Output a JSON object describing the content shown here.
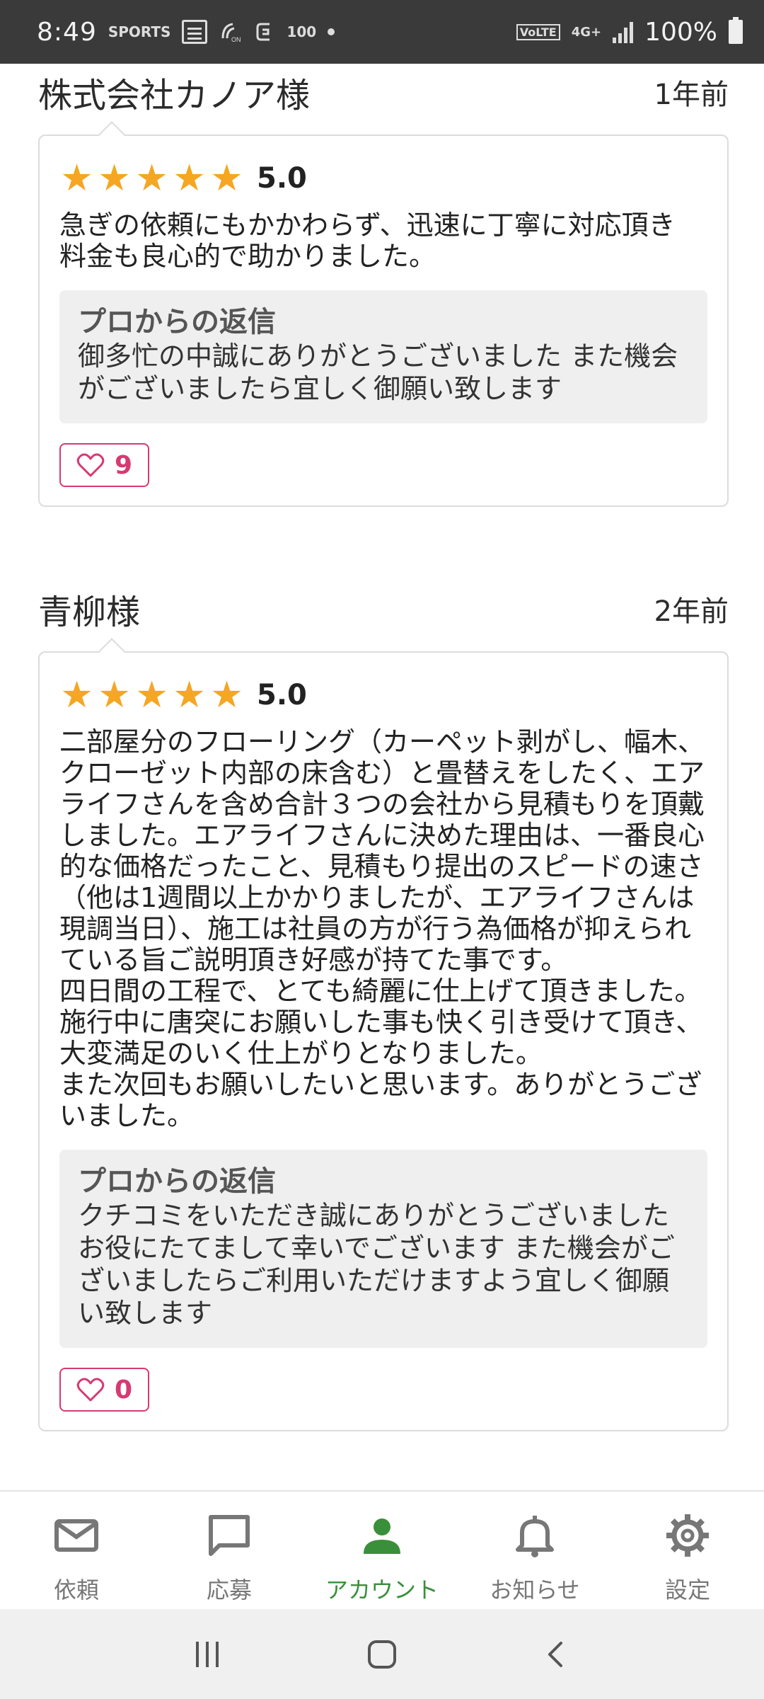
{
  "status_bar": {
    "time": "8:49",
    "left_icons": [
      "sports-news-icon",
      "calendar-icon",
      "nfc-icon",
      "app-icon"
    ],
    "notif_text": "SPORTS",
    "count_text": "100",
    "network_label": "VoLTE",
    "net_type": "4G+",
    "battery_pct": "100%"
  },
  "reviews": [
    {
      "name": "株式会社カノア様",
      "date": "1年前",
      "rating": 5,
      "score": "5.0",
      "comment": "急ぎの依頼にもかかわらず、迅速に丁寧に対応頂き\n料金も良心的で助かりました。",
      "reply_title": "プロからの返信",
      "reply_text": "御多忙の中誠にありがとうございました また機会がございましたら宜しく御願い致します",
      "likes": "9"
    },
    {
      "name": "青柳様",
      "date": "2年前",
      "rating": 5,
      "score": "5.0",
      "comment": "二部屋分のフローリング（カーペット剥がし、幅木、クローゼット内部の床含む）と畳替えをしたく、エアライフさんを含め合計３つの会社から見積もりを頂戴しました。エアライフさんに決めた理由は、一番良心的な価格だったこと、見積もり提出のスピードの速さ（他は1週間以上かかりましたが、エアライフさんは現調当日）、施工は社員の方が行う為価格が抑えられている旨ご説明頂き好感が持てた事です。\n四日間の工程で、とても綺麗に仕上げて頂きました。施行中に唐突にお願いした事も快く引き受けて頂き、大変満足のいく仕上がりとなりました。\nまた次回もお願いしたいと思います。ありがとうございました。",
      "reply_title": "プロからの返信",
      "reply_text": "クチコミをいただき誠にありがとうございました お役にたてまして幸いでございます また機会がございましたらご利用いただけますよう宜しく御願い致します",
      "likes": "0"
    }
  ],
  "bottom_nav": {
    "items": [
      {
        "label": "依頼",
        "icon": "mail-icon"
      },
      {
        "label": "応募",
        "icon": "chat-bubble-icon"
      },
      {
        "label": "アカウント",
        "icon": "person-icon"
      },
      {
        "label": "お知らせ",
        "icon": "bell-icon"
      },
      {
        "label": "設定",
        "icon": "gear-icon"
      }
    ],
    "active_index": 2
  },
  "colors": {
    "star": "#f5a623",
    "like": "#d63a73",
    "active_nav": "#3a8f3a",
    "inactive_nav": "#777777"
  }
}
